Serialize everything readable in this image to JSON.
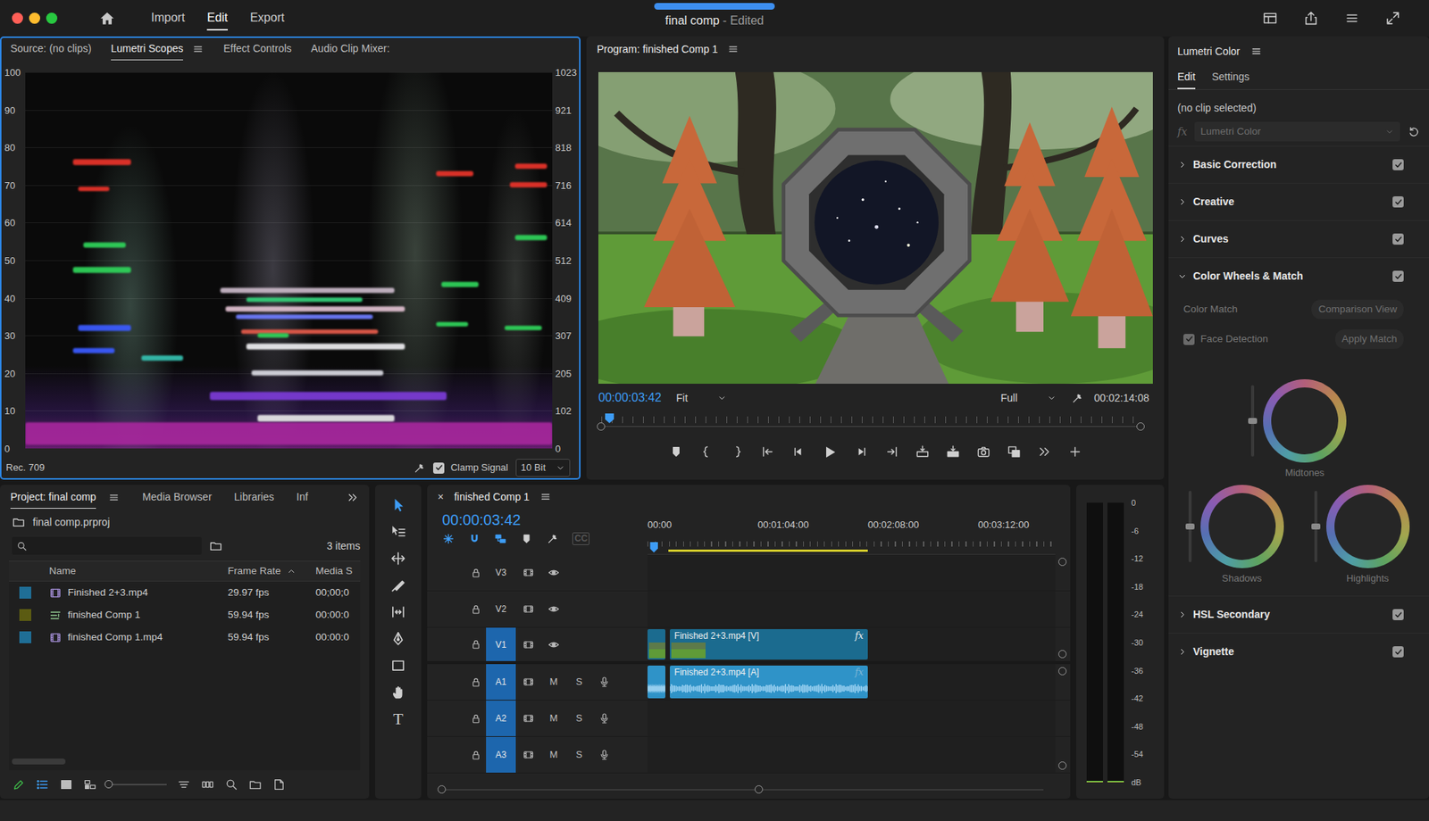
{
  "window": {
    "title": "final comp",
    "subtitle": "- Edited",
    "busy": true
  },
  "workspace_tabs": [
    {
      "label": "Import",
      "selected": false
    },
    {
      "label": "Edit",
      "selected": true
    },
    {
      "label": "Export",
      "selected": false
    }
  ],
  "scopes_panel": {
    "focused": true,
    "tabs": [
      {
        "label": "Source: (no clips)",
        "selected": false
      },
      {
        "label": "Lumetri Scopes",
        "selected": true
      },
      {
        "label": "Effect Controls",
        "selected": false
      },
      {
        "label": "Audio Clip Mixer:",
        "selected": false
      }
    ],
    "left_ticks": [
      "100",
      "90",
      "80",
      "70",
      "60",
      "50",
      "40",
      "30",
      "20",
      "10",
      "0"
    ],
    "right_ticks": [
      "1023",
      "921",
      "818",
      "716",
      "614",
      "512",
      "409",
      "307",
      "205",
      "102",
      "0"
    ],
    "streaks": [
      {
        "x0": 0.09,
        "x1": 0.2,
        "ire": 76,
        "band": 1.6,
        "color": "#e8332a"
      },
      {
        "x0": 0.1,
        "x1": 0.16,
        "ire": 69,
        "band": 1.3,
        "color": "#e8332a"
      },
      {
        "x0": 0.78,
        "x1": 0.85,
        "ire": 73,
        "band": 1.4,
        "color": "#e8332a"
      },
      {
        "x0": 0.92,
        "x1": 0.99,
        "ire": 70,
        "band": 1.4,
        "color": "#e8332a"
      },
      {
        "x0": 0.93,
        "x1": 0.99,
        "ire": 75,
        "band": 1.3,
        "color": "#e8332a"
      },
      {
        "x0": 0.09,
        "x1": 0.2,
        "ire": 47.5,
        "band": 1.6,
        "color": "#2fd35a"
      },
      {
        "x0": 0.11,
        "x1": 0.19,
        "ire": 54,
        "band": 1.3,
        "color": "#2fd35a"
      },
      {
        "x0": 0.93,
        "x1": 0.99,
        "ire": 56,
        "band": 1.4,
        "color": "#2fd35a"
      },
      {
        "x0": 0.79,
        "x1": 0.86,
        "ire": 43.5,
        "band": 1.4,
        "color": "#2fd35a"
      },
      {
        "x0": 0.91,
        "x1": 0.98,
        "ire": 32,
        "band": 1.3,
        "color": "#2fd35a"
      },
      {
        "x0": 0.78,
        "x1": 0.84,
        "ire": 33,
        "band": 1.3,
        "color": "#2fd35a"
      },
      {
        "x0": 0.1,
        "x1": 0.2,
        "ire": 32,
        "band": 1.5,
        "color": "#3b5bff"
      },
      {
        "x0": 0.09,
        "x1": 0.17,
        "ire": 26,
        "band": 1.3,
        "color": "#3b5bff"
      },
      {
        "x0": 0.37,
        "x1": 0.7,
        "ire": 42,
        "band": 1.4,
        "color": "#c9b8c8"
      },
      {
        "x0": 0.38,
        "x1": 0.72,
        "ire": 37,
        "band": 1.4,
        "color": "#e0c0d0"
      },
      {
        "x0": 0.4,
        "x1": 0.66,
        "ire": 35,
        "band": 1.3,
        "color": "#6e7cff"
      },
      {
        "x0": 0.42,
        "x1": 0.72,
        "ire": 27,
        "band": 1.6,
        "color": "#ededf0"
      },
      {
        "x0": 0.43,
        "x1": 0.68,
        "ire": 20,
        "band": 1.4,
        "color": "#d8d8e0"
      },
      {
        "x0": 0.44,
        "x1": 0.7,
        "ire": 8,
        "band": 1.6,
        "color": "#e6e6e6"
      },
      {
        "x0": 0.35,
        "x1": 0.8,
        "ire": 14,
        "band": 2.2,
        "color": "#7b3bd6"
      },
      {
        "x0": 0,
        "x1": 1,
        "ire": 4,
        "band": 6,
        "color": "#a5279b"
      },
      {
        "x0": 0.22,
        "x1": 0.3,
        "ire": 24,
        "band": 1.4,
        "color": "#35c0b0"
      },
      {
        "x0": 0.41,
        "x1": 0.67,
        "ire": 31,
        "band": 1.3,
        "color": "#e25a4a"
      },
      {
        "x0": 0.42,
        "x1": 0.64,
        "ire": 39.5,
        "band": 1.3,
        "color": "#34d07a"
      },
      {
        "x0": 0.44,
        "x1": 0.5,
        "ire": 30,
        "band": 1.2,
        "color": "#2fd35a"
      }
    ],
    "colorspace": "Rec. 709",
    "clamp_signal": {
      "label": "Clamp Signal",
      "checked": true
    },
    "bit_depth": "10 Bit"
  },
  "program": {
    "title": "Program: finished Comp 1",
    "timecode": "00:00:03:42",
    "zoom": "Fit",
    "quality": "Full",
    "duration": "00:02:14:08",
    "playhead": 0.015
  },
  "lumetri": {
    "title": "Lumetri Color",
    "tabs": [
      {
        "label": "Edit",
        "selected": true
      },
      {
        "label": "Settings",
        "selected": false
      }
    ],
    "clip_status": "(no clip selected)",
    "fx": "fx",
    "effect": "Lumetri Color",
    "sections": [
      {
        "label": "Basic Correction",
        "expanded": false,
        "enabled": true
      },
      {
        "label": "Creative",
        "expanded": false,
        "enabled": true
      },
      {
        "label": "Curves",
        "expanded": false,
        "enabled": true
      },
      {
        "label": "Color Wheels & Match",
        "expanded": true,
        "enabled": true
      },
      {
        "label": "HSL Secondary",
        "expanded": false,
        "enabled": true
      },
      {
        "label": "Vignette",
        "expanded": false,
        "enabled": true
      }
    ],
    "color_match": {
      "label": "Color Match",
      "comparison_button": "Comparison View",
      "face_detection": {
        "label": "Face Detection",
        "checked": true
      },
      "apply_button": "Apply Match"
    },
    "wheels": [
      {
        "label": "Midtones",
        "level": 0.5
      },
      {
        "label": "Shadows",
        "level": 0.5
      },
      {
        "label": "Highlights",
        "level": 0.5
      }
    ]
  },
  "project": {
    "tabs": [
      {
        "label": "Project: final comp",
        "selected": true
      },
      {
        "label": "Media Browser",
        "selected": false
      },
      {
        "label": "Libraries",
        "selected": false
      },
      {
        "label": "Inf",
        "selected": false
      }
    ],
    "file": "final comp.prproj",
    "item_count": "3 items",
    "columns": [
      {
        "label": "Name",
        "sorted": false
      },
      {
        "label": "Frame Rate",
        "sorted": true
      },
      {
        "label": "Media S",
        "sorted": false
      }
    ],
    "rows": [
      {
        "name": "Finished 2+3.mp4",
        "frame_rate": "29.97 fps",
        "media_start": "00;00;0",
        "color": "#1f6e96",
        "kind": "clip"
      },
      {
        "name": "finished Comp 1",
        "frame_rate": "59.94 fps",
        "media_start": "00:00:0",
        "color": "#5b5b12",
        "kind": "sequence"
      },
      {
        "name": "finished Comp 1.mp4",
        "frame_rate": "59.94 fps",
        "media_start": "00:00:0",
        "color": "#1f6e96",
        "kind": "clip"
      }
    ],
    "views": [
      {
        "kind": "list",
        "selected": true
      },
      {
        "kind": "icon",
        "selected": false
      },
      {
        "kind": "freeform",
        "selected": false
      }
    ],
    "zoom": 0.03
  },
  "tools": [
    {
      "kind": "selection",
      "selected": true
    },
    {
      "kind": "track-select",
      "selected": false
    },
    {
      "kind": "ripple",
      "selected": false
    },
    {
      "kind": "razor",
      "selected": false
    },
    {
      "kind": "slip",
      "selected": false
    },
    {
      "kind": "pen",
      "selected": false
    },
    {
      "kind": "rectangle",
      "selected": false
    },
    {
      "kind": "hand",
      "selected": false
    },
    {
      "kind": "type",
      "selected": false,
      "label": "T"
    }
  ],
  "timeline": {
    "tab": "finished Comp 1",
    "close": "×",
    "timecode": "00:00:03:42",
    "toolbar": [
      {
        "kind": "nest",
        "on": true
      },
      {
        "kind": "magnet",
        "on": true
      },
      {
        "kind": "linked",
        "on": true
      },
      {
        "kind": "marker",
        "on": false
      },
      {
        "kind": "wrench",
        "on": false
      },
      {
        "kind": "captions",
        "on": false,
        "label": "CC"
      }
    ],
    "span_seconds": 237,
    "playhead_seconds": 3.7,
    "work_area": {
      "start": 12,
      "end": 128
    },
    "ruler": [
      {
        "label": "00:00",
        "seconds": 0
      },
      {
        "label": "00:01:04:00",
        "seconds": 64
      },
      {
        "label": "00:02:08:00",
        "seconds": 128
      },
      {
        "label": "00:03:12:00",
        "seconds": 192
      }
    ],
    "tracks": [
      {
        "name": "V3",
        "kind": "video",
        "targeted": false
      },
      {
        "name": "V2",
        "kind": "video",
        "targeted": false
      },
      {
        "name": "V1",
        "kind": "video",
        "targeted": true
      },
      {
        "name": "A1",
        "kind": "audio",
        "targeted": true,
        "mute": "M",
        "solo": "S"
      },
      {
        "name": "A2",
        "kind": "audio",
        "targeted": true,
        "mute": "M",
        "solo": "S"
      },
      {
        "name": "A3",
        "kind": "audio",
        "targeted": true,
        "mute": "M",
        "solo": "S"
      }
    ],
    "clips": [
      {
        "track": 2,
        "kind": "video",
        "start": 0,
        "end": 10.5
      },
      {
        "track": 2,
        "kind": "video",
        "start": 13,
        "end": 128,
        "label": "Finished 2+3.mp4 [V]",
        "fx": "fx",
        "fx_active": true
      },
      {
        "track": 3,
        "kind": "audio",
        "start": 0,
        "end": 10.5
      },
      {
        "track": 3,
        "kind": "audio",
        "start": 13,
        "end": 128,
        "label": "Finished 2+3.mp4 [A]",
        "fx": "fx",
        "fx_active": false
      }
    ]
  },
  "meter": {
    "ticks": [
      "0",
      "-6",
      "-12",
      "-18",
      "-24",
      "-30",
      "-36",
      "-42",
      "-48",
      "-54",
      "dB"
    ],
    "channels": [
      {
        "level": 0.006
      },
      {
        "level": 0.006
      }
    ]
  }
}
